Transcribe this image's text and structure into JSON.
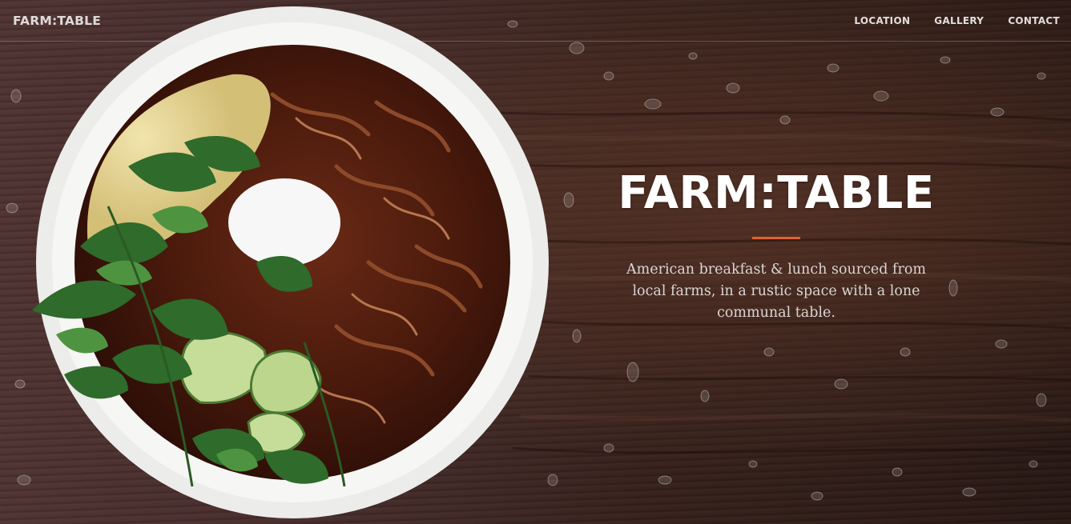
{
  "navbar": {
    "brand": "FARM:TABLE",
    "links": [
      "LOCATION",
      "GALLERY",
      "CONTACT"
    ]
  },
  "hero": {
    "title": "FARM:TABLE",
    "subtitle": "American breakfast & lunch sourced from local farms, in a rustic space with a lone communal table."
  },
  "colors": {
    "accent": "#e4622c",
    "text": "#ffffff"
  }
}
